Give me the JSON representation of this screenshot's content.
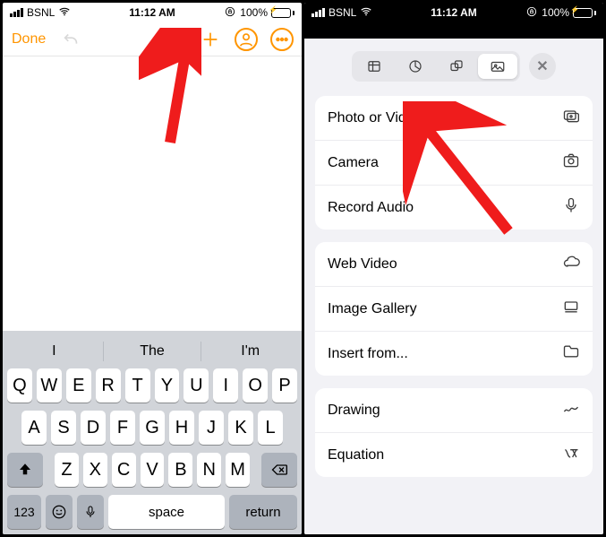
{
  "status": {
    "carrier": "BSNL",
    "time": "11:12 AM",
    "battery_pct": "100%"
  },
  "left": {
    "done": "Done",
    "suggestions": [
      "I",
      "The",
      "I'm"
    ],
    "rows": {
      "r1": [
        "Q",
        "W",
        "E",
        "R",
        "T",
        "Y",
        "U",
        "I",
        "O",
        "P"
      ],
      "r2": [
        "A",
        "S",
        "D",
        "F",
        "G",
        "H",
        "J",
        "K",
        "L"
      ],
      "r3": [
        "Z",
        "X",
        "C",
        "V",
        "B",
        "N",
        "M"
      ]
    },
    "k123": "123",
    "space": "space",
    "return": "return"
  },
  "right": {
    "group1": {
      "photo": "Photo or Video",
      "camera": "Camera",
      "audio": "Record Audio"
    },
    "group2": {
      "web": "Web Video",
      "gallery": "Image Gallery",
      "insert": "Insert from..."
    },
    "group3": {
      "drawing": "Drawing",
      "equation": "Equation"
    }
  }
}
